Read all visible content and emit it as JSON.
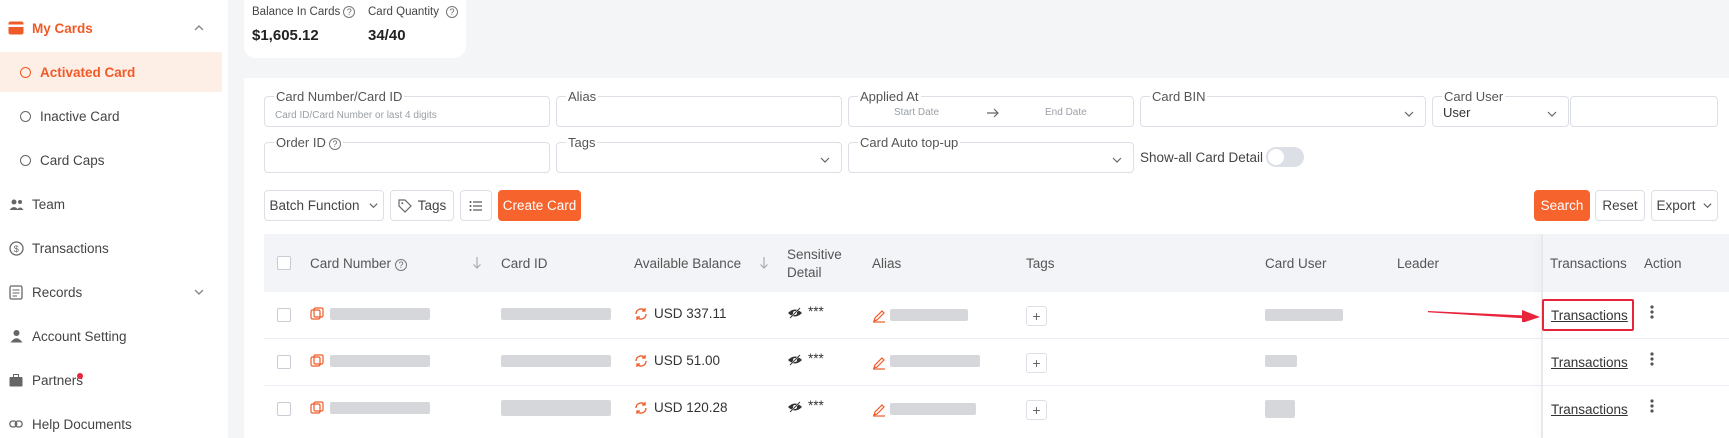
{
  "sidebar": {
    "parent_label": "My Cards",
    "items": [
      {
        "label": "Activated Card"
      },
      {
        "label": "Inactive Card"
      },
      {
        "label": "Card Caps"
      },
      {
        "label": "Team"
      },
      {
        "label": "Transactions"
      },
      {
        "label": "Records"
      },
      {
        "label": "Account Setting"
      },
      {
        "label": "Partners"
      },
      {
        "label": "Help Documents"
      }
    ]
  },
  "stats": {
    "balance_label": "Balance In Cards",
    "balance_value": "$1,605.12",
    "quantity_label": "Card Quantity",
    "quantity_value": "34/40"
  },
  "filters": {
    "card_number_label": "Card Number/Card ID",
    "card_number_placeholder": "Card ID/Card Number or last 4 digits",
    "alias_label": "Alias",
    "applied_at_label": "Applied At",
    "start_date": "Start Date",
    "end_date": "End Date",
    "card_bin_label": "Card BIN",
    "card_user_label": "Card User",
    "card_user_value": "User",
    "order_id_label": "Order ID",
    "tags_label": "Tags",
    "auto_topup_label": "Card Auto top-up",
    "show_all_label": "Show-all Card Detail"
  },
  "toolbar": {
    "batch_label": "Batch Function",
    "tags_label": "Tags",
    "create_label": "Create Card",
    "search_label": "Search",
    "reset_label": "Reset",
    "export_label": "Export"
  },
  "table": {
    "headers": {
      "card_number": "Card Number",
      "card_id": "Card ID",
      "available_balance": "Available Balance",
      "sensitive_line1": "Sensitive",
      "sensitive_line2": "Detail",
      "alias": "Alias",
      "tags": "Tags",
      "card_user": "Card User",
      "leader": "Leader",
      "transactions": "Transactions",
      "action": "Action"
    },
    "rows": [
      {
        "balance": "USD 337.11",
        "masked": "***",
        "transactions": "Transactions"
      },
      {
        "balance": "USD 51.00",
        "masked": "***",
        "transactions": "Transactions"
      },
      {
        "balance": "USD 120.28",
        "masked": "***",
        "transactions": "Transactions"
      }
    ]
  },
  "colors": {
    "accent": "#f7632c",
    "annotation": "#e8243c"
  }
}
